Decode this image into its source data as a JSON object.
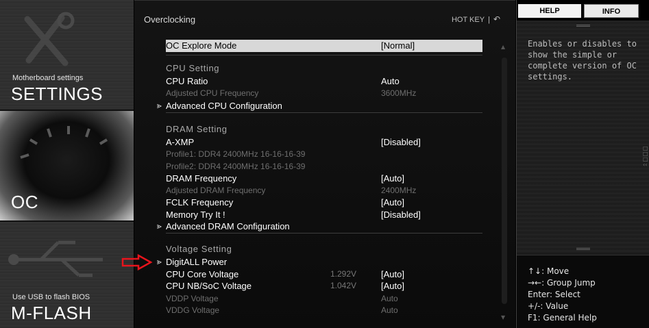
{
  "sidebar": {
    "settings": {
      "subtitle": "Motherboard settings",
      "title": "SETTINGS"
    },
    "oc": {
      "title": "OC"
    },
    "mflash": {
      "subtitle": "Use USB to flash BIOS",
      "title": "M-FLASH"
    }
  },
  "header": {
    "breadcrumb": "Overclocking",
    "hotkey_label": "HOT KEY",
    "separator": "|",
    "back_icon": "back-arrow-icon"
  },
  "rows": {
    "oc_explore": {
      "label": "OC Explore Mode",
      "value": "[Normal]"
    },
    "cpu_header": {
      "label": "CPU Setting"
    },
    "cpu_ratio": {
      "label": "CPU Ratio",
      "value": "Auto"
    },
    "adj_cpu_freq": {
      "label": "Adjusted CPU Frequency",
      "value": "3600MHz"
    },
    "adv_cpu": {
      "label": "Advanced CPU Configuration"
    },
    "dram_header": {
      "label": "DRAM Setting"
    },
    "axmp": {
      "label": "A-XMP",
      "value": "[Disabled]"
    },
    "profile1": {
      "label": "Profile1: DDR4 2400MHz 16-16-16-39"
    },
    "profile2": {
      "label": "Profile2: DDR4 2400MHz 16-16-16-39"
    },
    "dram_freq": {
      "label": "DRAM Frequency",
      "value": "[Auto]"
    },
    "adj_dram_freq": {
      "label": "Adjusted DRAM Frequency",
      "value": "2400MHz"
    },
    "fclk": {
      "label": "FCLK Frequency",
      "value": "[Auto]"
    },
    "memory_try": {
      "label": "Memory Try It !",
      "value": "[Disabled]"
    },
    "adv_dram": {
      "label": "Advanced DRAM Configuration"
    },
    "volt_header": {
      "label": "Voltage Setting"
    },
    "digitall": {
      "label": "DigitALL Power"
    },
    "cpu_core_v": {
      "label": "CPU Core Voltage",
      "reading": "1.292V",
      "value": "[Auto]"
    },
    "cpu_nb_v": {
      "label": "CPU NB/SoC Voltage",
      "reading": "1.042V",
      "value": "[Auto]"
    },
    "vddp": {
      "label": "VDDP Voltage",
      "value": "Auto"
    },
    "vddg": {
      "label": "VDDG Voltage",
      "value": "Auto"
    }
  },
  "help_panel": {
    "tab_help": "HELP",
    "tab_info": "INFO",
    "text": "Enables or disables to show the simple or complete version of OC settings.",
    "keys": {
      "move": "↑↓: Move",
      "group": "→←: Group Jump",
      "enter": "Enter: Select",
      "value": "+/-: Value",
      "f1": "F1: General Help"
    }
  },
  "colors": {
    "selection_bg": "#d8d8d8",
    "pointer_arrow": "#e8141c",
    "dim_text": "#6f6f6f"
  }
}
